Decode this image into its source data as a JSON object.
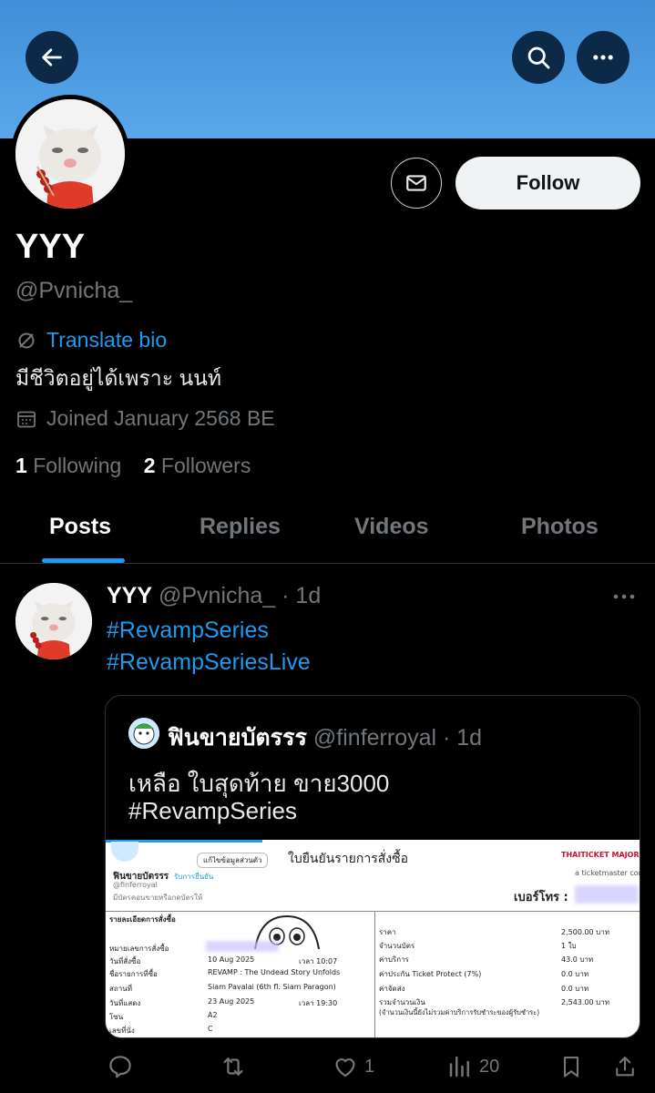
{
  "profile": {
    "name": "YYY",
    "handle": "@Pvnicha_",
    "translate_label": "Translate bio",
    "bio": "มีชีวิตอยู่ได้เพราะ นนท์",
    "joined": "Joined January 2568 BE",
    "following_count": "1",
    "following_label": "Following",
    "followers_count": "2",
    "followers_label": "Followers",
    "follow_button": "Follow"
  },
  "tabs": [
    {
      "label": "Posts"
    },
    {
      "label": "Replies"
    },
    {
      "label": "Videos"
    },
    {
      "label": "Photos"
    }
  ],
  "post": {
    "author": "YYY",
    "handle_time": "@Pvnicha_ · 1d",
    "hashtags": [
      "#RevampSeries",
      "#RevampSeriesLive"
    ],
    "quote": {
      "author": "ฟินขายบัตรรร",
      "handle_time": "@finferroyal · 1d",
      "text_lines": [
        "เหลือ ใบสุดท้าย ขาย3000",
        "#RevampSeries"
      ],
      "receipt": {
        "title": "ใบยืนยันรายการสั่งซื้อ",
        "edit_label": "แก้ไขข้อมูลส่วนตัว",
        "shop_name": "ฟินขายบัตรรร",
        "shop_handle": "@finferroyal",
        "shop_desc": "มีบัตรคอนขายหรือกดบัตรให้",
        "verified_label": "รับการยืนยัน",
        "brand": "THAITICKET MAJOR",
        "brand_sub": "a ticketmaster company",
        "phone_label": "เบอร์โทร :",
        "section_title": "รายละเอียดการสั่งซื้อ",
        "left_rows": [
          {
            "label": "หมายเลขการสั่งซื้อ",
            "value": ""
          },
          {
            "label": "วันที่สั่งซื้อ",
            "value": "10 Aug 2025",
            "time_label": "เวลา 10:07"
          },
          {
            "label": "ชื่อรายการที่ซื้อ",
            "value": "REVAMP : The Undead Story Unfolds"
          },
          {
            "label": "สถานที่",
            "value": "Siam Pavalai (6th fl. Siam Paragon)"
          },
          {
            "label": "วันที่แสดง",
            "value": "23 Aug 2025",
            "time_label": "เวลา 19:30"
          },
          {
            "label": "โซน",
            "value": "A2"
          },
          {
            "label": "เลขที่นั่ง",
            "value": "C"
          }
        ],
        "right_rows": [
          {
            "label": "ราคา",
            "value": "2,500.00 บาท"
          },
          {
            "label": "จำนวนบัตร",
            "value": "1 ใบ"
          },
          {
            "label": "ค่าบริการ",
            "value": "43.0 บาท"
          },
          {
            "label": "ค่าประกัน Ticket Protect (7%)",
            "value": "0.0 บาท"
          },
          {
            "label": "ค่าจัดส่ง",
            "value": "0.0 บาท"
          },
          {
            "label": "รวมจำนวนเงิน",
            "value": "2,543.00 บาท"
          }
        ],
        "footnote": "(จำนวนเงินนี้ยังไม่รวมค่าบริการรับชำระของผู้รับชำระ)"
      }
    },
    "likes": "1",
    "views": "20"
  },
  "colors": {
    "accent": "#1d9bf0",
    "banner": "#4a9be3",
    "background": "#000000",
    "muted": "#71767b"
  }
}
